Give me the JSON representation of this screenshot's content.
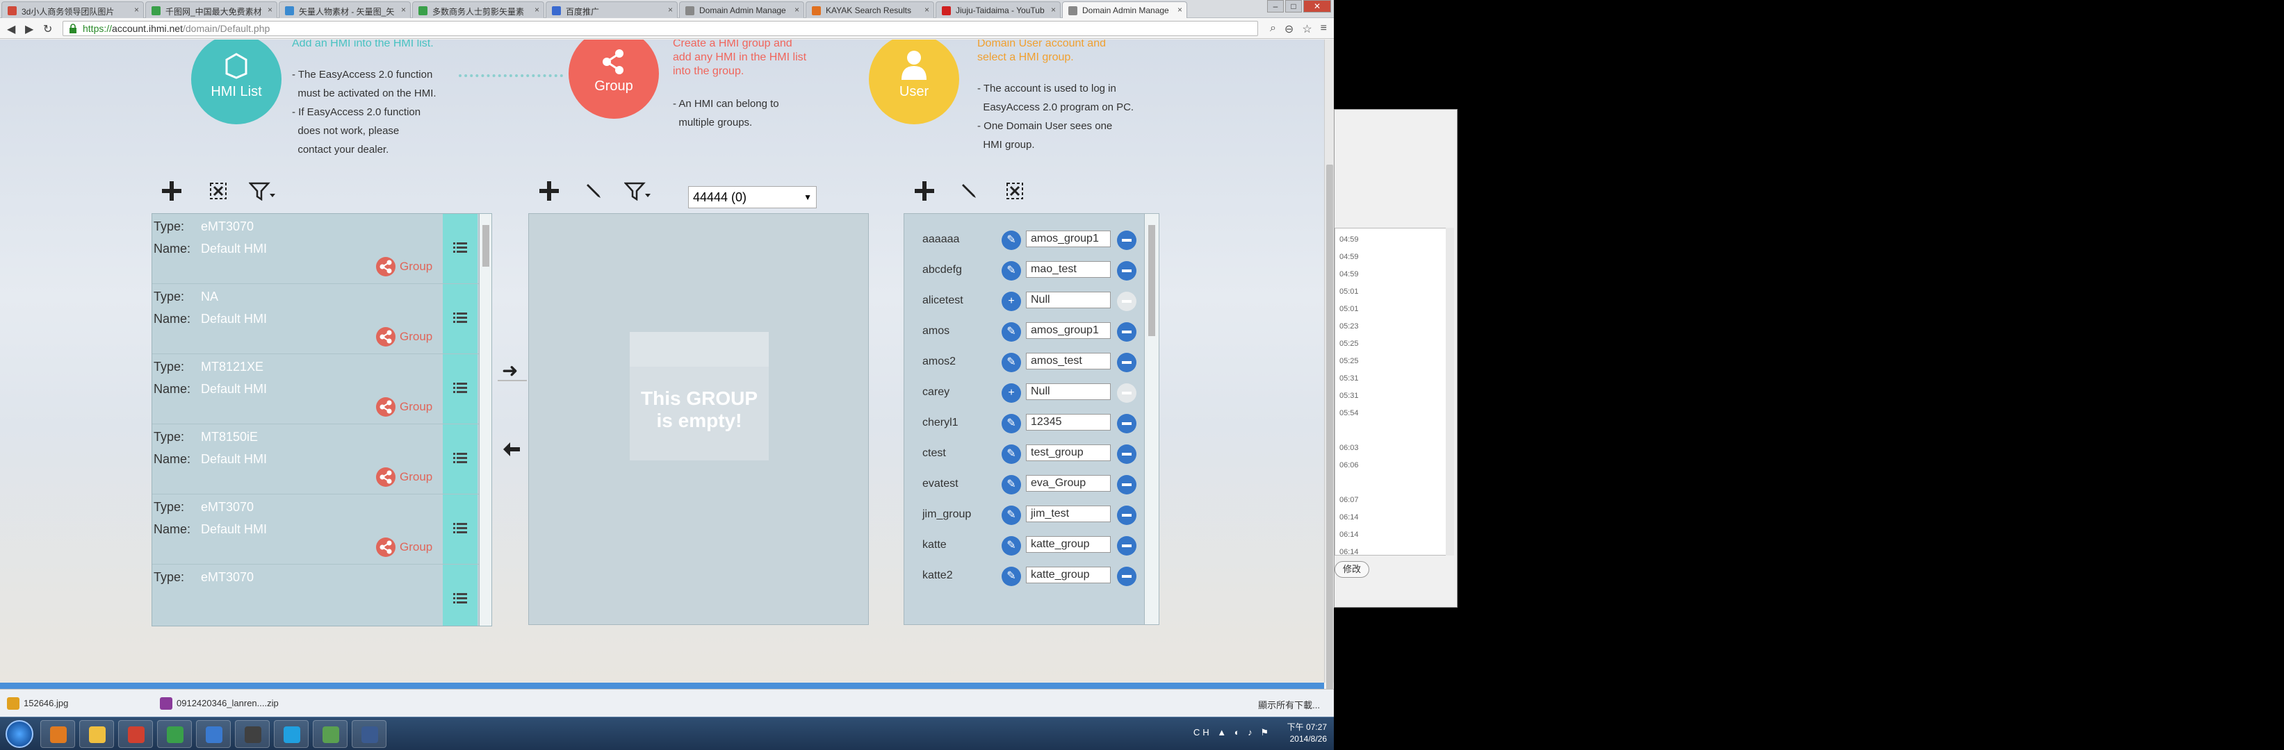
{
  "browser": {
    "tabs": [
      {
        "label": "3d小人商务领导团队图片",
        "active": false,
        "color": "#d04a3a"
      },
      {
        "label": "千图网_中国最大免费素材",
        "active": false,
        "color": "#3aa04a"
      },
      {
        "label": "矢量人物素材 - 矢量图_矢",
        "active": false,
        "color": "#3a8ad0"
      },
      {
        "label": "多数商务人士剪影矢量素",
        "active": false,
        "color": "#3aa04a"
      },
      {
        "label": "百度推广",
        "active": false,
        "color": "#3a6ad0"
      },
      {
        "label": "Domain Admin Manage",
        "active": false,
        "color": "#888888"
      },
      {
        "label": "KAYAK Search Results",
        "active": false,
        "color": "#e07020"
      },
      {
        "label": "Jiuju-Taidaima - YouTub",
        "active": false,
        "color": "#d02020"
      },
      {
        "label": "Domain Admin Manage",
        "active": true,
        "color": "#888888"
      }
    ],
    "url_scheme": "https://",
    "url_host": "account.ihmi.net",
    "url_path": "/domain/Default.php"
  },
  "hero": {
    "hmi": {
      "circle_label": "HMI List",
      "heading": "Add an HMI into the HMI list.",
      "lines": [
        "- The EasyAccess 2.0 function",
        "  must be activated on the HMI.",
        "- If EasyAccess 2.0 function",
        "  does not work, please",
        "  contact your dealer."
      ],
      "color": "#49c2c1"
    },
    "group": {
      "circle_label": "Group",
      "heading_lines": [
        "Create a HMI group and",
        "add any HMI in the HMI list",
        "into the group."
      ],
      "lines": [
        "- An HMI can belong to",
        "  multiple groups."
      ],
      "color": "#f0665c"
    },
    "user": {
      "circle_label": "User",
      "heading_lines": [
        "Domain User account and",
        "select a HMI group."
      ],
      "lines": [
        "- The account is used to log in",
        "  EasyAccess 2.0 program on PC.",
        "- One Domain User sees one",
        "  HMI group."
      ],
      "color": "#f5c93c"
    }
  },
  "hmi_list": {
    "type_label": "Type:",
    "name_label": "Name:",
    "group_label": "Group",
    "items": [
      {
        "type": "eMT3070",
        "name": "Default HMI"
      },
      {
        "type": "NA",
        "name": "Default HMI"
      },
      {
        "type": "MT8121XE",
        "name": "Default HMI"
      },
      {
        "type": "MT8150iE",
        "name": "Default HMI"
      },
      {
        "type": "eMT3070",
        "name": "Default HMI"
      },
      {
        "type": "eMT3070",
        "name": ""
      }
    ]
  },
  "group_panel": {
    "selected_group": "44444 (0)",
    "empty_line1": "This GROUP",
    "empty_line2": "is empty!"
  },
  "users": [
    {
      "name": "aaaaaa",
      "group": "amos_group1",
      "assigned": true
    },
    {
      "name": "abcdefg",
      "group": "mao_test",
      "assigned": true
    },
    {
      "name": "alicetest",
      "group": "Null",
      "assigned": false
    },
    {
      "name": "amos",
      "group": "amos_group1",
      "assigned": true
    },
    {
      "name": "amos2",
      "group": "amos_test",
      "assigned": true
    },
    {
      "name": "carey",
      "group": "Null",
      "assigned": false
    },
    {
      "name": "cheryl1",
      "group": "12345",
      "assigned": true
    },
    {
      "name": "ctest",
      "group": "test_group",
      "assigned": true
    },
    {
      "name": "evatest",
      "group": "eva_Group",
      "assigned": true
    },
    {
      "name": "jim_group",
      "group": "jim_test",
      "assigned": true
    },
    {
      "name": "katte",
      "group": "katte_group",
      "assigned": true
    },
    {
      "name": "katte2",
      "group": "katte_group",
      "assigned": true
    }
  ],
  "downloads": {
    "items": [
      {
        "label": "152646.jpg",
        "color": "#e0a020"
      },
      {
        "label": "0912420346_lanren....zip",
        "color": "#8a3a9a"
      }
    ],
    "show_all": "顯示所有下載..."
  },
  "taskbar": {
    "time": "下午 07:27",
    "date": "2014/8/26",
    "ime": "CH",
    "apps": [
      {
        "color": "#e07a20"
      },
      {
        "color": "#f0c040"
      },
      {
        "color": "#d04030"
      },
      {
        "color": "#3aa04a"
      },
      {
        "color": "#3a7ad0"
      },
      {
        "color": "#404040"
      },
      {
        "color": "#20a0e0"
      },
      {
        "color": "#5aa050"
      },
      {
        "color": "#3a5a90"
      }
    ]
  },
  "bg_window": {
    "times": [
      "04:59",
      "04:59",
      "04:59",
      "05:01",
      "05:01",
      "05:23",
      "05:25",
      "05:25",
      "05:31",
      "05:31",
      "05:54",
      "",
      "06:03",
      "06:06",
      "",
      "06:07",
      "06:14",
      "06:14",
      "06:14"
    ],
    "button": "修改"
  }
}
